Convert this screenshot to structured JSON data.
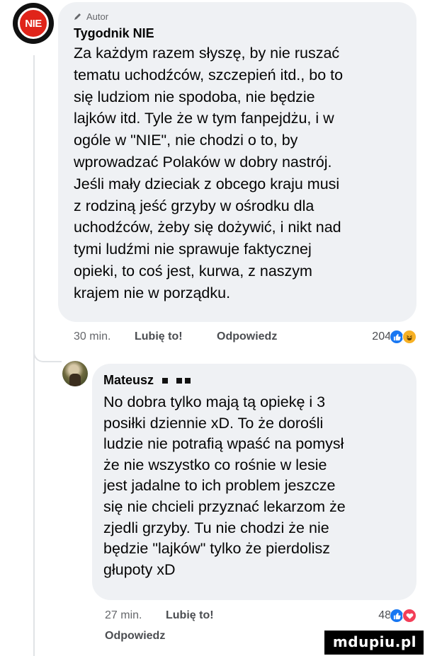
{
  "comment1": {
    "author_badge": "Autor",
    "author_name": "Tygodnik NIE",
    "avatar_text": "NIE",
    "text": "Za każdym razem słyszę, by nie ruszać\ntematu uchodźców, szczepień itd., bo to\nsię ludziom nie spodoba, nie będzie\nlajków itd. Tyle że w tym fanpejdżu, i w\nogóle w \"NIE\", nie chodzi o to, by\nwprowadzać Polaków w dobry nastrój.\nJeśli mały dzieciak z obcego kraju musi\nz rodziną jeść grzyby w ośrodku dla\nuchodźców, żeby się dożywić, i nikt nad\ntymi ludźmi nie sprawuje faktycznej\nopieki, to coś jest, kurwa, z naszym\nkrajem nie w porządku.",
    "time": "30 min.",
    "like_label": "Lubię to!",
    "reply_label": "Odpowiedz",
    "reaction_count": "204",
    "reactions": [
      "like-icon",
      "haha-icon"
    ]
  },
  "comment2": {
    "author_name": "Mateusz",
    "text": "No dobra tylko mają tą opiekę i 3\nposiłki dziennie xD. To że dorośli\nludzie nie potrafią wpaść na pomysł\nże nie wszystko co rośnie w lesie\njest jadalne to ich problem jeszcze\nsię nie chcieli przyznać lekarzom że\nzjedli grzyby. Tu nie chodzi że nie\nbędzie \"lajków\" tylko że pierdolisz\ngłupoty xD",
    "time": "27 min.",
    "like_label": "Lubię to!",
    "reply_label": "Odpowiedz",
    "reaction_count": "48",
    "reactions": [
      "like-icon",
      "love-icon"
    ]
  },
  "watermark": "mdupiu.pl",
  "colors": {
    "bubble": "#eff1f4",
    "like": "#1877f2",
    "haha": "#f7b125",
    "love": "#f33e58",
    "nie_red": "#e0241a"
  }
}
